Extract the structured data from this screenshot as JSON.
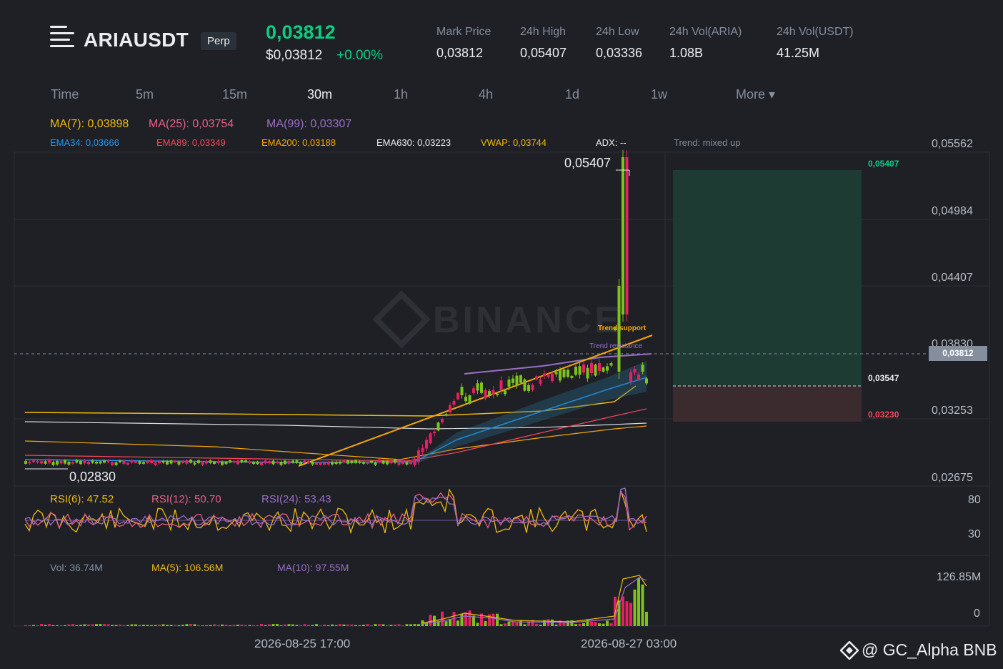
{
  "header": {
    "symbol": "ARIAUSDT",
    "contract_type": "Perp",
    "last_price": "0,03812",
    "usd_price": "$0,03812",
    "change": "+0.00%",
    "stats": [
      {
        "label": "Mark Price",
        "value": "0,03812"
      },
      {
        "label": "24h High",
        "value": "0,05407"
      },
      {
        "label": "24h Low",
        "value": "0,03336"
      },
      {
        "label": "24h Vol(ARIA)",
        "value": "1.08B"
      },
      {
        "label": "24h Vol(USDT)",
        "value": "41.25M"
      }
    ]
  },
  "timeframes": [
    "Time",
    "5m",
    "15m",
    "30m",
    "1h",
    "4h",
    "1d",
    "1w",
    "More ▾"
  ],
  "active_timeframe": "30m",
  "indicators": {
    "ma": [
      {
        "label": "MA(7): 0,03898",
        "color": "#f0b90b"
      },
      {
        "label": "MA(25): 0,03754",
        "color": "#e95f86"
      },
      {
        "label": "MA(99): 0,03307",
        "color": "#9a6fc4"
      }
    ],
    "ema": [
      {
        "label": "EMA34: 0,03666",
        "color": "#2196f3"
      },
      {
        "label": "EMA89: 0,03349",
        "color": "#f6465d"
      },
      {
        "label": "EMA200: 0,03188",
        "color": "#f7a600"
      },
      {
        "label": "EMA630: 0,03223",
        "color": "#eaecef"
      },
      {
        "label": "VWAP: 0,03744",
        "color": "#f0b90b"
      },
      {
        "label": "ADX: --",
        "color": "#eaecef"
      },
      {
        "label": "Trend: mixed up",
        "color": "#848e9c"
      }
    ]
  },
  "price_axis": [
    "0,05562",
    "0,04984",
    "0,04407",
    "0,03830",
    "0,03253",
    "0,02675"
  ],
  "current_price_tag": "0,03812",
  "annotations": {
    "high_label": "0,05407",
    "low_label": "0,02830",
    "trend_support": "Trend support",
    "trend_resistance": "Trend resistance"
  },
  "position": {
    "take_profit": "0,05407",
    "entry": "0,03547",
    "stop_loss": "0,03230",
    "tp_color": "#0ecb81",
    "sl_color": "#f6465d"
  },
  "rsi": {
    "labels": [
      {
        "label": "RSI(6): 47.52",
        "color": "#f0b90b"
      },
      {
        "label": "RSI(12): 50.70",
        "color": "#e95f86"
      },
      {
        "label": "RSI(24): 53.43",
        "color": "#9a6fc4"
      }
    ],
    "axis": [
      "80",
      "30"
    ]
  },
  "volume": {
    "labels": [
      {
        "label": "Vol: 36.74M",
        "color": "#848e9c"
      },
      {
        "label": "MA(5): 106.56M",
        "color": "#f0b90b"
      },
      {
        "label": "MA(10): 97.55M",
        "color": "#9a6fc4"
      }
    ],
    "axis": [
      "126.85M",
      "0"
    ]
  },
  "time_axis": [
    "2026-08-25 17:00",
    "2026-08-27 03:00"
  ],
  "watermark": "BINANCE",
  "credit": "@ GC_Alpha BNB",
  "colors": {
    "up": "#7ec31b",
    "down": "#e91e63",
    "background": "#1e2026",
    "accent": "#f0b90b"
  }
}
